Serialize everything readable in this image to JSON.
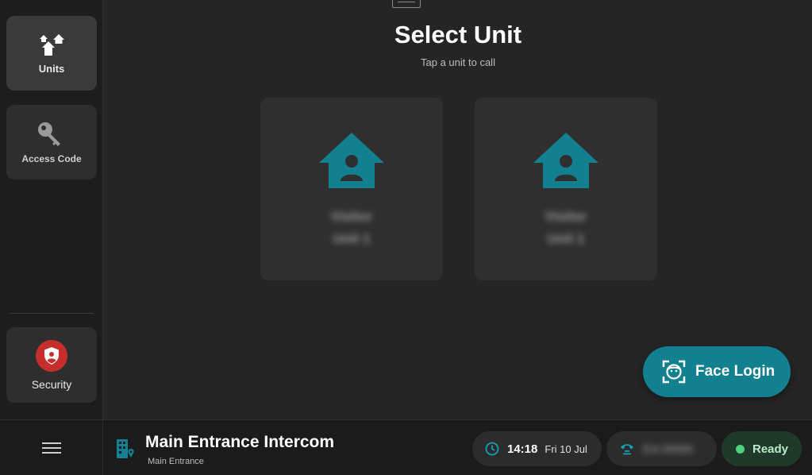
{
  "sidebar": {
    "items": [
      {
        "label": "Units",
        "icon": "homes-icon"
      },
      {
        "label": "Access Code",
        "icon": "key-icon"
      }
    ],
    "security": {
      "label": "Security",
      "icon": "shield-user-icon",
      "color": "#c62e2e"
    }
  },
  "main": {
    "title": "Select Unit",
    "subtitle": "Tap a unit to call",
    "units": [
      {
        "name_line1": "Visitor",
        "name_line2": "Unit 1"
      },
      {
        "name_line1": "Visitor",
        "name_line2": "Unit 1"
      }
    ],
    "face_login": {
      "label": "Face Login",
      "icon": "face-scan-icon"
    }
  },
  "bottombar": {
    "location_title": "Main Entrance Intercom",
    "location_subtitle": "Main Entrance",
    "time": "14:18",
    "date": "Fri 10 Jul",
    "phone": "Ext 00000",
    "status": "Ready"
  },
  "colors": {
    "accent": "#12808e",
    "status_ok": "#4cd37a",
    "danger": "#c62e2e"
  }
}
